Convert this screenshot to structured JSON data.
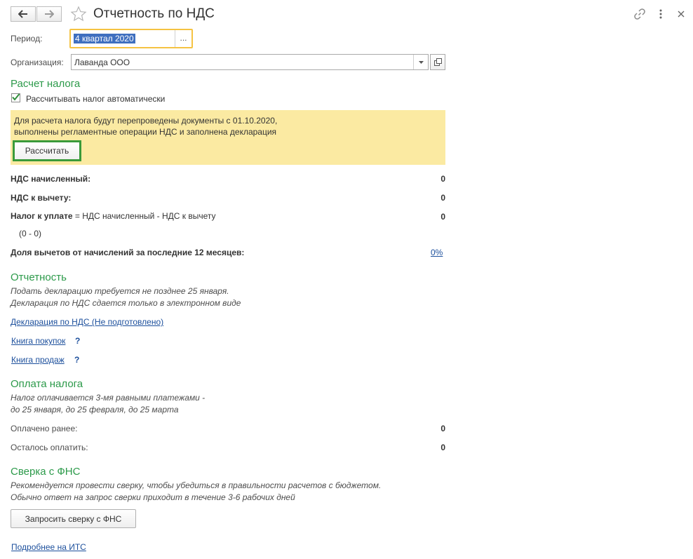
{
  "header": {
    "title": "Отчетность по НДС",
    "icons": {
      "back": "arrow-left-icon",
      "forward": "arrow-right-icon",
      "favorite": "star-icon",
      "link": "link-icon",
      "more": "more-vertical-icon",
      "close": "close-icon"
    }
  },
  "period": {
    "label": "Период:",
    "value": "4 квартал 2020",
    "select_label": "..."
  },
  "organization": {
    "label": "Организация:",
    "value": "Лаванда ООО"
  },
  "tax_calc": {
    "heading": "Расчет налога",
    "auto_checkbox_label": "Рассчитывать налог автоматически",
    "auto_checked": true,
    "note_line1": "Для расчета налога будут перепроведены документы с 01.10.2020,",
    "note_line2": "выполнены регламентные операции НДС и заполнена декларация",
    "calc_button": "Рассчитать"
  },
  "values": {
    "vat_accrued_label": "НДС начисленный:",
    "vat_accrued_value": "0",
    "vat_deduct_label": "НДС к вычету:",
    "vat_deduct_value": "0",
    "tax_payable_label_bold": "Налог к уплате",
    "tax_payable_label_rest": " = НДС начисленный - НДС к вычету",
    "tax_payable_value": "0",
    "formula": "(0 - 0)",
    "share_label": "Доля вычетов от начислений за последние 12 месяцев:",
    "share_value": "0%"
  },
  "reporting": {
    "heading": "Отчетность",
    "line1": "Подать декларацию требуется не позднее 25 января.",
    "line2": "Декларация по НДС сдается только в электронном виде",
    "declaration_link": "Декларация по НДС (Не подготовлено)",
    "purchase_book_link": "Книга покупок",
    "sales_book_link": "Книга продаж",
    "help_mark": "?"
  },
  "payment": {
    "heading": "Оплата налога",
    "line1": "Налог оплачивается 3-мя равными платежами -",
    "line2": "до 25 января, до 25 февраля, до 25 марта",
    "paid_label": "Оплачено ранее:",
    "paid_value": "0",
    "remaining_label": "Осталось оплатить:",
    "remaining_value": "0"
  },
  "fns": {
    "heading": "Сверка с ФНС",
    "line1": "Рекомендуется провести сверку, чтобы убедиться в правильности расчетов с бюджетом.",
    "line2": "Обычно ответ на запрос сверки приходит в течение 3-6 рабочих дней",
    "request_button": "Запросить сверку с ФНС",
    "its_link": "Подробнее на ИТС"
  }
}
